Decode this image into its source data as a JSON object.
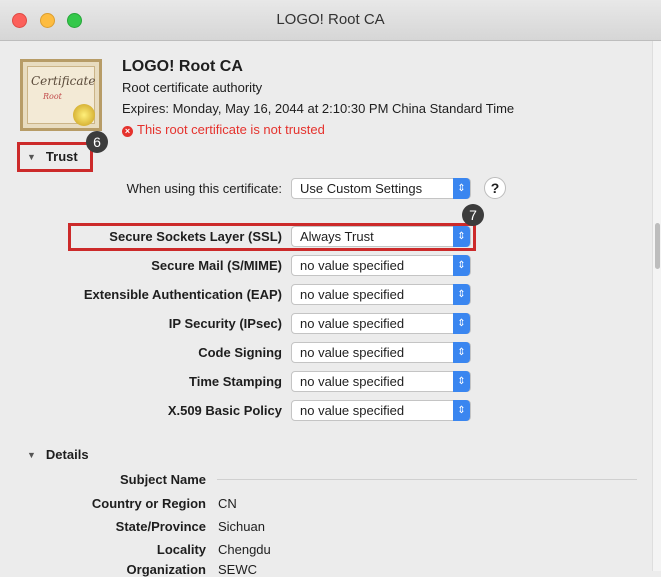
{
  "window": {
    "title": "LOGO! Root CA"
  },
  "certificate": {
    "icon_text": "Certificate",
    "icon_subtext": "Root",
    "name": "LOGO! Root CA",
    "type": "Root certificate authority",
    "expires": "Expires: Monday, May 16, 2044 at 2:10:30 PM China Standard Time",
    "warning": "This root certificate is not trusted",
    "warning_icon": "x-circle-icon"
  },
  "trust": {
    "header": "Trust",
    "when_using_label": "When using this certificate:",
    "when_using_value": "Use Custom Settings",
    "help": "?",
    "rows": [
      {
        "label": "Secure Sockets Layer (SSL)",
        "value": "Always Trust"
      },
      {
        "label": "Secure Mail (S/MIME)",
        "value": "no value specified"
      },
      {
        "label": "Extensible Authentication (EAP)",
        "value": "no value specified"
      },
      {
        "label": "IP Security (IPsec)",
        "value": "no value specified"
      },
      {
        "label": "Code Signing",
        "value": "no value specified"
      },
      {
        "label": "Time Stamping",
        "value": "no value specified"
      },
      {
        "label": "X.509 Basic Policy",
        "value": "no value specified"
      }
    ]
  },
  "annotations": {
    "badge_trust": "6",
    "badge_ssl": "7",
    "highlight_color": "#cc2a2a"
  },
  "details": {
    "header": "Details",
    "subject_name": "Subject Name",
    "rows": [
      {
        "label": "Country or Region",
        "value": "CN"
      },
      {
        "label": "State/Province",
        "value": "Sichuan"
      },
      {
        "label": "Locality",
        "value": "Chengdu"
      },
      {
        "label": "Organization",
        "value": "SEWC"
      }
    ]
  }
}
